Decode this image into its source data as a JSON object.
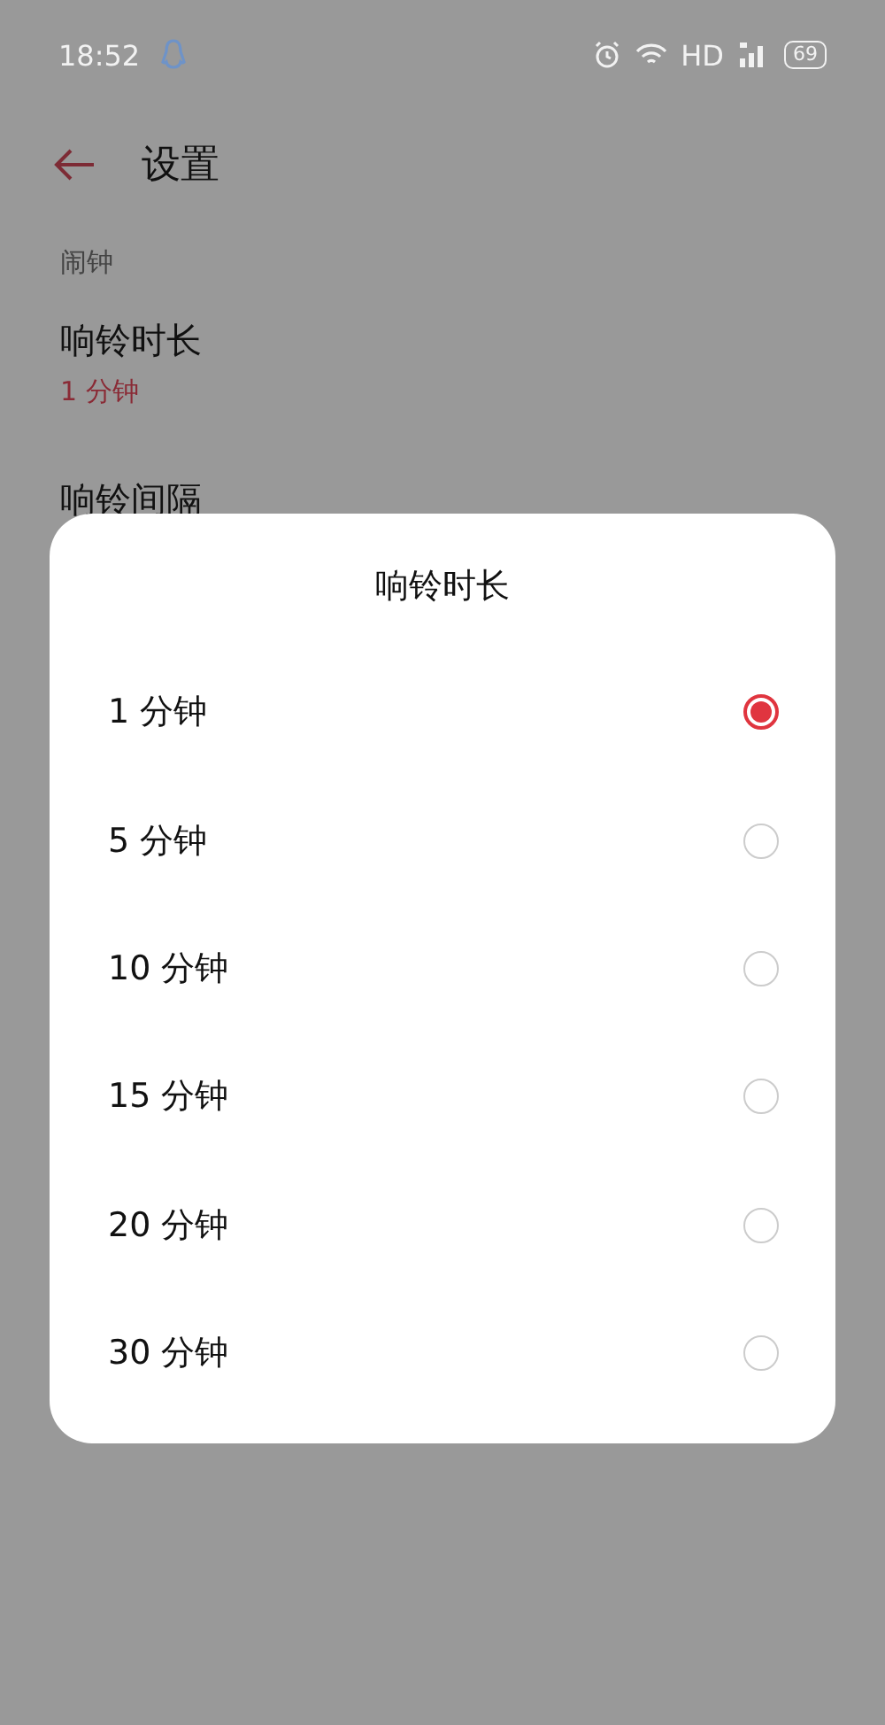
{
  "status_bar": {
    "time": "18:52",
    "network": "HD",
    "battery": "69"
  },
  "header": {
    "title": "设置"
  },
  "section": {
    "title": "闹钟"
  },
  "settings": [
    {
      "title": "响铃时长",
      "value": "1 分钟"
    },
    {
      "title": "响铃间隔"
    }
  ],
  "dialog": {
    "title": "响铃时长",
    "options": [
      {
        "label": "1 分钟",
        "selected": true
      },
      {
        "label": "5 分钟",
        "selected": false
      },
      {
        "label": "10 分钟",
        "selected": false
      },
      {
        "label": "15 分钟",
        "selected": false
      },
      {
        "label": "20 分钟",
        "selected": false
      },
      {
        "label": "30 分钟",
        "selected": false
      }
    ]
  }
}
